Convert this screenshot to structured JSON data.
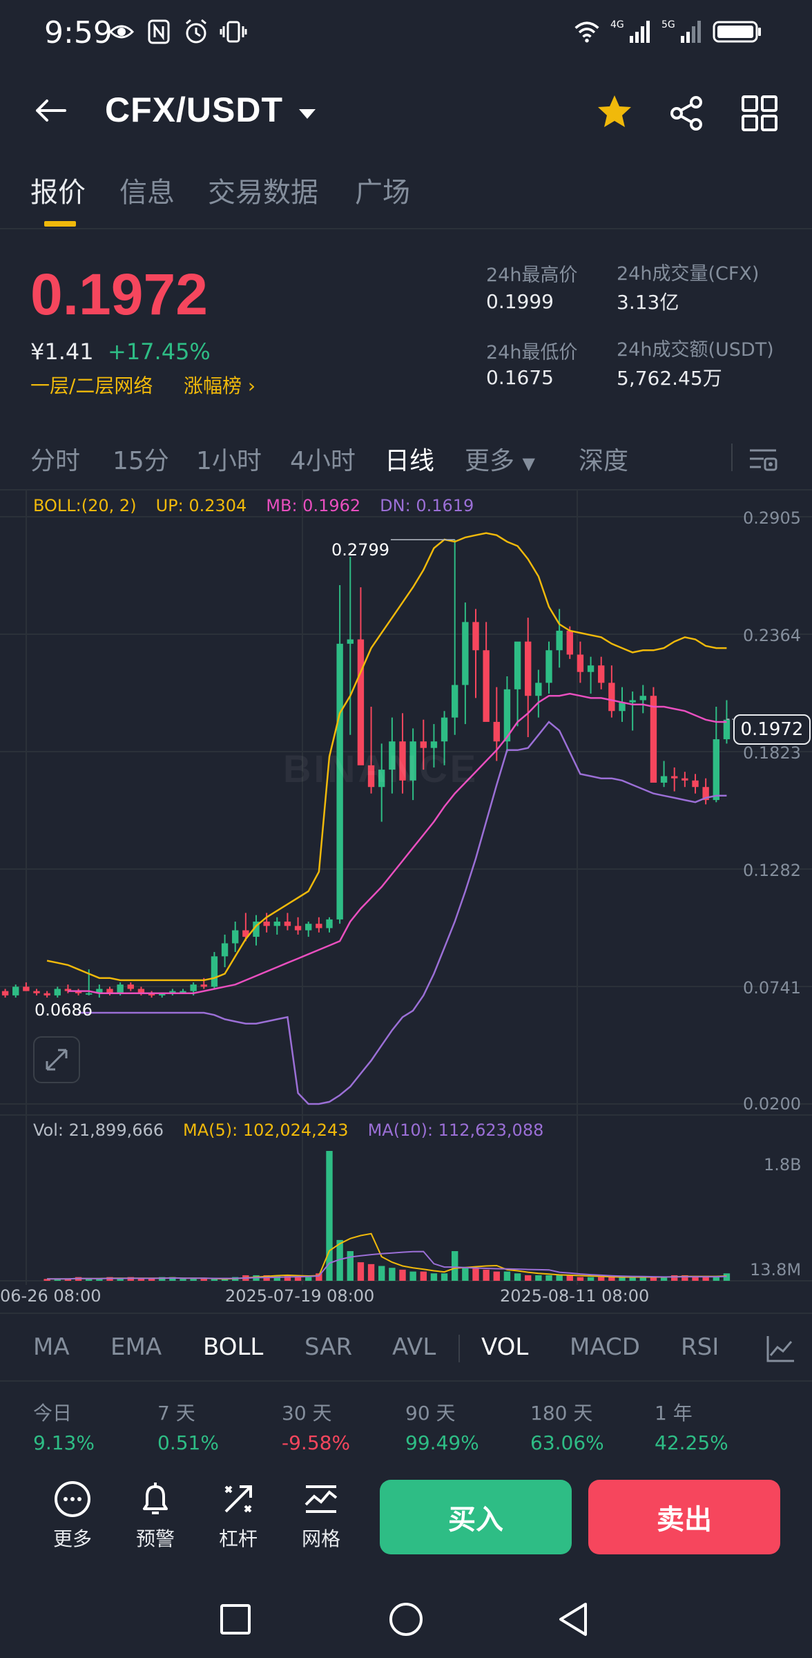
{
  "status_bar": {
    "time": "9:59",
    "net1": "4G",
    "net2": "5G"
  },
  "header": {
    "pair": "CFX/USDT"
  },
  "top_tabs": [
    "报价",
    "信息",
    "交易数据",
    "广场"
  ],
  "price": {
    "last": "0.1972",
    "cny": "¥1.41",
    "change": "+17.45%",
    "network": "一层/二层网络",
    "gainers": "涨幅榜",
    "stats": [
      {
        "label": "24h最高价",
        "value": "0.1999"
      },
      {
        "label": "24h成交量(CFX)",
        "value": "3.13亿"
      },
      {
        "label": "24h最低价",
        "value": "0.1675"
      },
      {
        "label": "24h成交额(USDT)",
        "value": "5,762.45万"
      }
    ]
  },
  "intervals": [
    "分时",
    "15分",
    "1小时",
    "4小时",
    "日线",
    "更多",
    "深度"
  ],
  "chart": {
    "boll": {
      "name": "BOLL:(20, 2)",
      "up": "UP: 0.2304",
      "mb": "MB: 0.1962",
      "dn": "DN: 0.1619"
    },
    "vol": {
      "vol": "Vol: 21,899,666",
      "ma5": "MA(5): 102,024,243",
      "ma10": "MA(10): 112,623,088"
    },
    "price_axis": [
      "0.2905",
      "0.2364",
      "0.1823",
      "0.1282",
      "0.0741",
      "0.0200"
    ],
    "vol_axis": [
      "1.8B",
      "13.8M"
    ],
    "dates": [
      "06-26 08:00",
      "2025-07-19 08:00",
      "2025-08-11 08:00"
    ],
    "high_label": "0.2799",
    "low_label": "0.0686",
    "last_tag": "0.1972",
    "watermark": "BINANCE",
    "colors": {
      "up": "#2ebd85",
      "down": "#f6465d",
      "boll_up": "#f0b90b",
      "boll_mb": "#e94fbf",
      "boll_dn": "#9b6fd6"
    }
  },
  "chart_data": {
    "type": "candlestick",
    "x_ticks": [
      "06-26 08:00",
      "2025-07-19 08:00",
      "2025-08-11 08:00"
    ],
    "candles_ohlc": [
      [
        0.072,
        0.073,
        0.069,
        0.07
      ],
      [
        0.07,
        0.075,
        0.069,
        0.074
      ],
      [
        0.074,
        0.076,
        0.072,
        0.072
      ],
      [
        0.072,
        0.073,
        0.07,
        0.071
      ],
      [
        0.071,
        0.072,
        0.069,
        0.07
      ],
      [
        0.07,
        0.074,
        0.069,
        0.073
      ],
      [
        0.073,
        0.075,
        0.071,
        0.072
      ],
      [
        0.072,
        0.073,
        0.07,
        0.071
      ],
      [
        0.071,
        0.082,
        0.07,
        0.071
      ],
      [
        0.071,
        0.075,
        0.069,
        0.073
      ],
      [
        0.073,
        0.074,
        0.07,
        0.071
      ],
      [
        0.071,
        0.076,
        0.07,
        0.075
      ],
      [
        0.075,
        0.076,
        0.072,
        0.073
      ],
      [
        0.073,
        0.074,
        0.07,
        0.071
      ],
      [
        0.071,
        0.072,
        0.069,
        0.07
      ],
      [
        0.07,
        0.071,
        0.069,
        0.071
      ],
      [
        0.071,
        0.073,
        0.07,
        0.072
      ],
      [
        0.072,
        0.073,
        0.071,
        0.072
      ],
      [
        0.072,
        0.076,
        0.07,
        0.075
      ],
      [
        0.075,
        0.078,
        0.073,
        0.074
      ],
      [
        0.074,
        0.09,
        0.073,
        0.088
      ],
      [
        0.088,
        0.098,
        0.083,
        0.094
      ],
      [
        0.094,
        0.104,
        0.09,
        0.1
      ],
      [
        0.1,
        0.108,
        0.095,
        0.097
      ],
      [
        0.097,
        0.107,
        0.093,
        0.104
      ],
      [
        0.104,
        0.108,
        0.099,
        0.102
      ],
      [
        0.102,
        0.106,
        0.098,
        0.104
      ],
      [
        0.104,
        0.108,
        0.1,
        0.102
      ],
      [
        0.102,
        0.106,
        0.098,
        0.1
      ],
      [
        0.1,
        0.104,
        0.097,
        0.103
      ],
      [
        0.103,
        0.106,
        0.099,
        0.101
      ],
      [
        0.101,
        0.106,
        0.099,
        0.105
      ],
      [
        0.105,
        0.259,
        0.103,
        0.232
      ],
      [
        0.232,
        0.272,
        0.19,
        0.234
      ],
      [
        0.234,
        0.258,
        0.177,
        0.176
      ],
      [
        0.176,
        0.203,
        0.163,
        0.166
      ],
      [
        0.166,
        0.186,
        0.15,
        0.174
      ],
      [
        0.174,
        0.198,
        0.163,
        0.187
      ],
      [
        0.187,
        0.2,
        0.163,
        0.169
      ],
      [
        0.169,
        0.193,
        0.16,
        0.187
      ],
      [
        0.187,
        0.197,
        0.174,
        0.184
      ],
      [
        0.184,
        0.195,
        0.175,
        0.187
      ],
      [
        0.187,
        0.201,
        0.176,
        0.198
      ],
      [
        0.198,
        0.28,
        0.19,
        0.213
      ],
      [
        0.213,
        0.251,
        0.195,
        0.242
      ],
      [
        0.242,
        0.248,
        0.207,
        0.229
      ],
      [
        0.229,
        0.242,
        0.198,
        0.196
      ],
      [
        0.196,
        0.212,
        0.178,
        0.187
      ],
      [
        0.187,
        0.217,
        0.182,
        0.211
      ],
      [
        0.211,
        0.229,
        0.194,
        0.233
      ],
      [
        0.233,
        0.244,
        0.189,
        0.208
      ],
      [
        0.208,
        0.22,
        0.198,
        0.214
      ],
      [
        0.214,
        0.233,
        0.209,
        0.229
      ],
      [
        0.229,
        0.248,
        0.221,
        0.238
      ],
      [
        0.238,
        0.24,
        0.225,
        0.227
      ],
      [
        0.227,
        0.233,
        0.214,
        0.219
      ],
      [
        0.219,
        0.226,
        0.209,
        0.222
      ],
      [
        0.222,
        0.226,
        0.211,
        0.214
      ],
      [
        0.214,
        0.222,
        0.198,
        0.201
      ],
      [
        0.201,
        0.212,
        0.196,
        0.205
      ],
      [
        0.205,
        0.21,
        0.192,
        0.206
      ],
      [
        0.206,
        0.213,
        0.2,
        0.208
      ],
      [
        0.208,
        0.212,
        0.19,
        0.168
      ],
      [
        0.168,
        0.178,
        0.166,
        0.171
      ],
      [
        0.171,
        0.175,
        0.164,
        0.17
      ],
      [
        0.17,
        0.173,
        0.166,
        0.169
      ],
      [
        0.169,
        0.172,
        0.163,
        0.166
      ],
      [
        0.166,
        0.17,
        0.158,
        0.16
      ],
      [
        0.16,
        0.203,
        0.159,
        0.188
      ],
      [
        0.188,
        0.206,
        0.186,
        0.197
      ]
    ],
    "boll_up": [
      0.086,
      0.085,
      0.084,
      0.082,
      0.08,
      0.078,
      0.078,
      0.077,
      0.077,
      0.077,
      0.077,
      0.077,
      0.077,
      0.077,
      0.077,
      0.077,
      0.078,
      0.08,
      0.088,
      0.096,
      0.102,
      0.106,
      0.109,
      0.112,
      0.115,
      0.118,
      0.127,
      0.18,
      0.2,
      0.208,
      0.219,
      0.23,
      0.237,
      0.244,
      0.251,
      0.258,
      0.266,
      0.276,
      0.28,
      0.279,
      0.281,
      0.282,
      0.283,
      0.282,
      0.279,
      0.277,
      0.271,
      0.263,
      0.249,
      0.241,
      0.238,
      0.237,
      0.236,
      0.235,
      0.232,
      0.23,
      0.228,
      0.229,
      0.229,
      0.23,
      0.233,
      0.235,
      0.234,
      0.231,
      0.23,
      0.23
    ],
    "boll_mb": [
      0.072,
      0.072,
      0.072,
      0.071,
      0.071,
      0.071,
      0.071,
      0.071,
      0.071,
      0.071,
      0.071,
      0.071,
      0.071,
      0.072,
      0.073,
      0.074,
      0.075,
      0.077,
      0.079,
      0.081,
      0.083,
      0.085,
      0.087,
      0.089,
      0.091,
      0.093,
      0.095,
      0.104,
      0.11,
      0.115,
      0.12,
      0.126,
      0.132,
      0.138,
      0.144,
      0.15,
      0.157,
      0.163,
      0.168,
      0.173,
      0.178,
      0.183,
      0.189,
      0.196,
      0.2,
      0.205,
      0.208,
      0.208,
      0.209,
      0.208,
      0.207,
      0.207,
      0.206,
      0.205,
      0.204,
      0.204,
      0.203,
      0.203,
      0.202,
      0.201,
      0.199,
      0.197,
      0.196,
      0.196
    ],
    "boll_dn": [
      0.062,
      0.062,
      0.062,
      0.062,
      0.062,
      0.062,
      0.062,
      0.062,
      0.062,
      0.062,
      0.062,
      0.062,
      0.062,
      0.061,
      0.059,
      0.058,
      0.057,
      0.057,
      0.058,
      0.059,
      0.06,
      0.025,
      0.02,
      0.02,
      0.021,
      0.024,
      0.028,
      0.034,
      0.04,
      0.047,
      0.054,
      0.06,
      0.063,
      0.07,
      0.08,
      0.092,
      0.104,
      0.118,
      0.133,
      0.15,
      0.167,
      0.183,
      0.183,
      0.184,
      0.19,
      0.196,
      0.192,
      0.182,
      0.172,
      0.171,
      0.17,
      0.17,
      0.169,
      0.167,
      0.165,
      0.163,
      0.162,
      0.161,
      0.16,
      0.159,
      0.161,
      0.162,
      0.162
    ],
    "volume_relative": [
      1,
      1,
      1,
      2,
      1,
      1,
      2,
      1,
      2,
      1,
      1,
      2,
      2,
      1,
      1,
      1,
      1,
      1,
      2,
      3,
      3,
      3,
      3,
      3,
      2,
      2,
      4,
      70,
      22,
      16,
      10,
      9,
      8,
      7,
      6,
      5,
      5,
      4,
      4,
      16,
      7,
      7,
      6,
      5,
      5,
      4,
      3,
      3,
      3,
      3,
      3,
      2,
      2,
      2,
      2,
      2,
      2,
      2,
      2,
      2,
      3,
      3,
      2,
      2,
      2,
      4
    ],
    "y_axis_ticks": [
      0.2905,
      0.2364,
      0.1823,
      0.1282,
      0.0741,
      0.02
    ],
    "volume_axis_ticks": [
      "1.8B",
      "13.8M"
    ]
  },
  "indicators": [
    "MA",
    "EMA",
    "BOLL",
    "SAR",
    "AVL",
    "VOL",
    "MACD",
    "RSI"
  ],
  "performance": [
    {
      "label": "今日",
      "value": "9.13%",
      "color": "#2ebd85"
    },
    {
      "label": "7 天",
      "value": "0.51%",
      "color": "#2ebd85"
    },
    {
      "label": "30 天",
      "value": "-9.58%",
      "color": "#f6465d"
    },
    {
      "label": "90 天",
      "value": "99.49%",
      "color": "#2ebd85"
    },
    {
      "label": "180 天",
      "value": "63.06%",
      "color": "#2ebd85"
    },
    {
      "label": "1 年",
      "value": "42.25%",
      "color": "#2ebd85"
    }
  ],
  "actions": {
    "more": "更多",
    "alert": "预警",
    "leverage": "杠杆",
    "grid": "网格",
    "buy": "买入",
    "sell": "卖出"
  }
}
